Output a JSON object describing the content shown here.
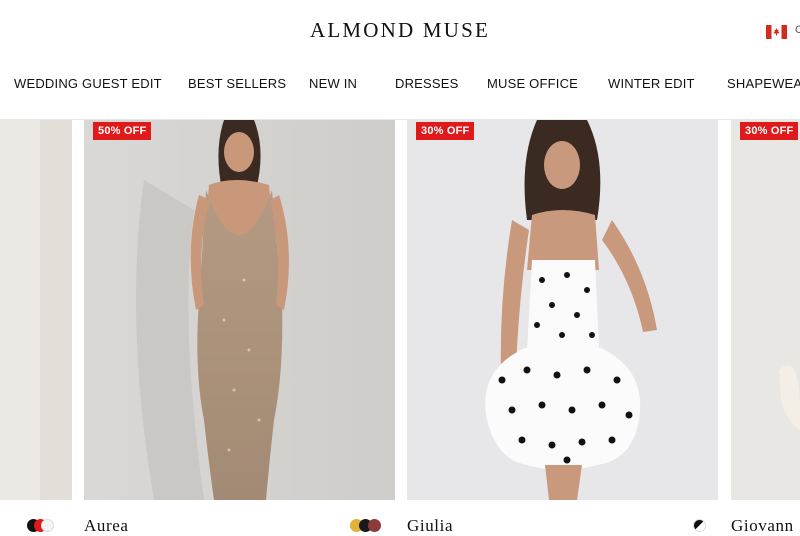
{
  "brand": {
    "logo_text": "ALMOND MUSE"
  },
  "header": {
    "country_code": "C",
    "flag": "canada-flag-icon"
  },
  "nav": {
    "items": [
      {
        "label": "WEDDING GUEST EDIT"
      },
      {
        "label": "BEST SELLERS"
      },
      {
        "label": "NEW IN"
      },
      {
        "label": "DRESSES"
      },
      {
        "label": "MUSE OFFICE"
      },
      {
        "label": "WINTER EDIT"
      },
      {
        "label": "SHAPEWEAR"
      }
    ]
  },
  "products": [
    {
      "name": "",
      "badge": "",
      "swatches": [
        "#111111",
        "#e01a1a",
        "#f4f4f4"
      ]
    },
    {
      "name": "Aurea",
      "badge": "50% OFF",
      "swatches": [
        "#e0b23a",
        "#1a1a1a",
        "#8c3a3a"
      ]
    },
    {
      "name": "Giulia",
      "badge": "30% OFF",
      "swatches": [
        "#111111",
        "#ffffff"
      ]
    },
    {
      "name": "Giovann",
      "badge": "30% OFF",
      "swatches": []
    }
  ],
  "colors": {
    "badge": "#e01a1a",
    "text": "#111111"
  }
}
